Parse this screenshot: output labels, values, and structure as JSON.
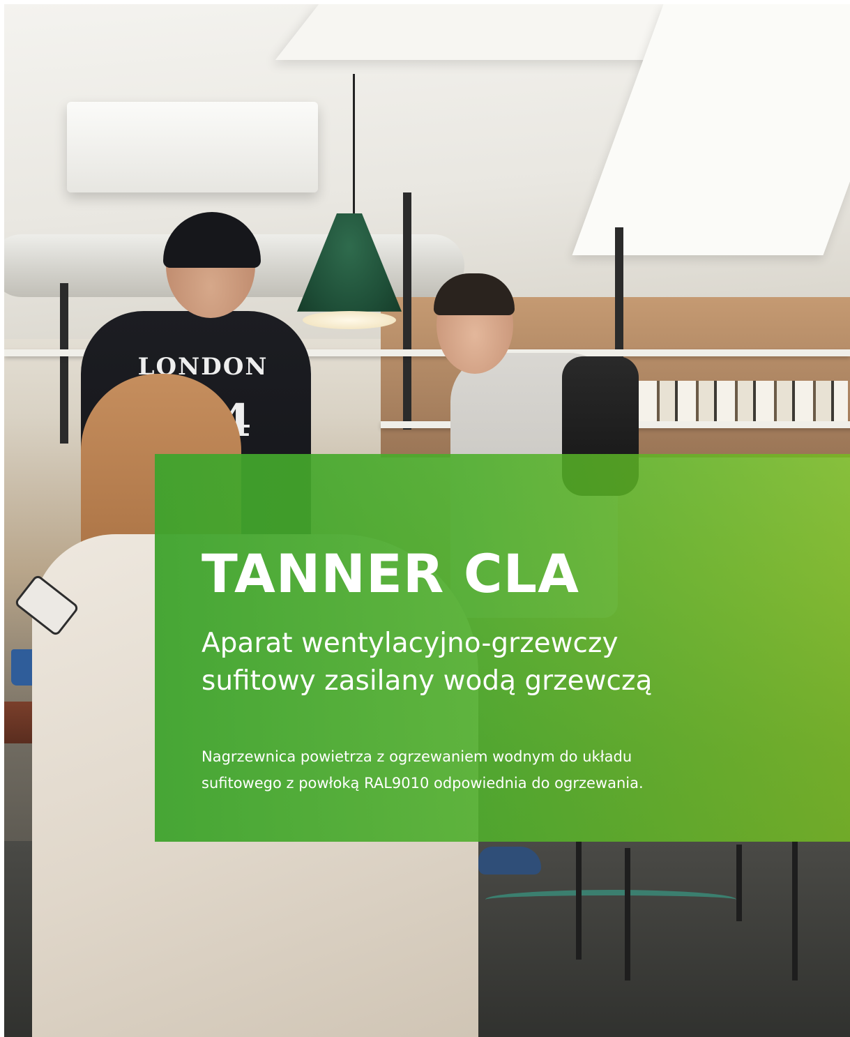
{
  "photo": {
    "shirt_text": "LONDON",
    "shirt_number": "4"
  },
  "hero": {
    "title": "TANNER CLA",
    "subtitle_lines": [
      "Aparat wentylacyjno-grzewczy",
      "sufitowy zasilany wodą grzewczą"
    ],
    "description_lines": [
      "Nagrzewnica powietrza z ogrzewaniem wodnym do układu",
      "sufitowego z powłoką RAL9010 odpowiednia do ogrzewania."
    ]
  },
  "colors": {
    "panel_green_start": "#3ea32d",
    "panel_green_end": "#75be1e",
    "text": "#ffffff"
  }
}
